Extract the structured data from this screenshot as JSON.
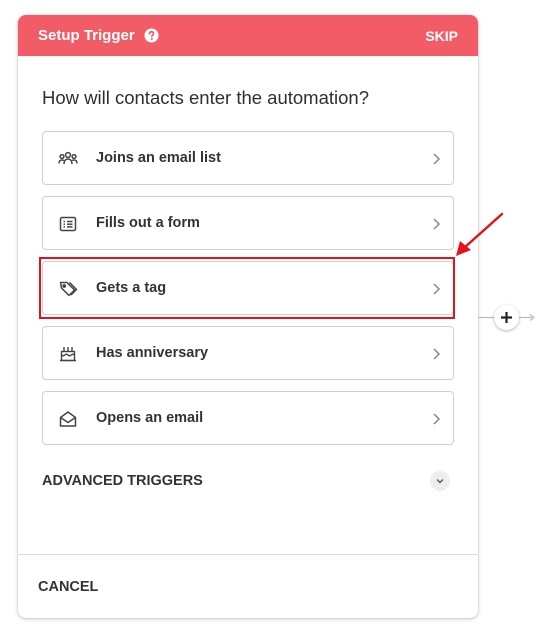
{
  "header": {
    "title": "Setup Trigger",
    "help_icon": "question-circle-icon",
    "skip_label": "SKIP",
    "color": "#f25c66"
  },
  "question": "How will contacts enter the automation?",
  "options": [
    {
      "label": "Joins an email list",
      "icon": "group-icon"
    },
    {
      "label": "Fills out a form",
      "icon": "form-list-icon"
    },
    {
      "label": "Gets a tag",
      "icon": "tag-icon"
    },
    {
      "label": "Has anniversary",
      "icon": "cake-icon"
    },
    {
      "label": "Opens an email",
      "icon": "open-envelope-icon"
    }
  ],
  "advanced": {
    "label": "ADVANCED TRIGGERS",
    "icon": "chevron-down-icon"
  },
  "footer": {
    "cancel_label": "CANCEL"
  },
  "annotation": {
    "highlight_color": "#e3121b",
    "highlighted_option": "Gets a tag"
  },
  "connector": {
    "icon": "plus-icon"
  }
}
